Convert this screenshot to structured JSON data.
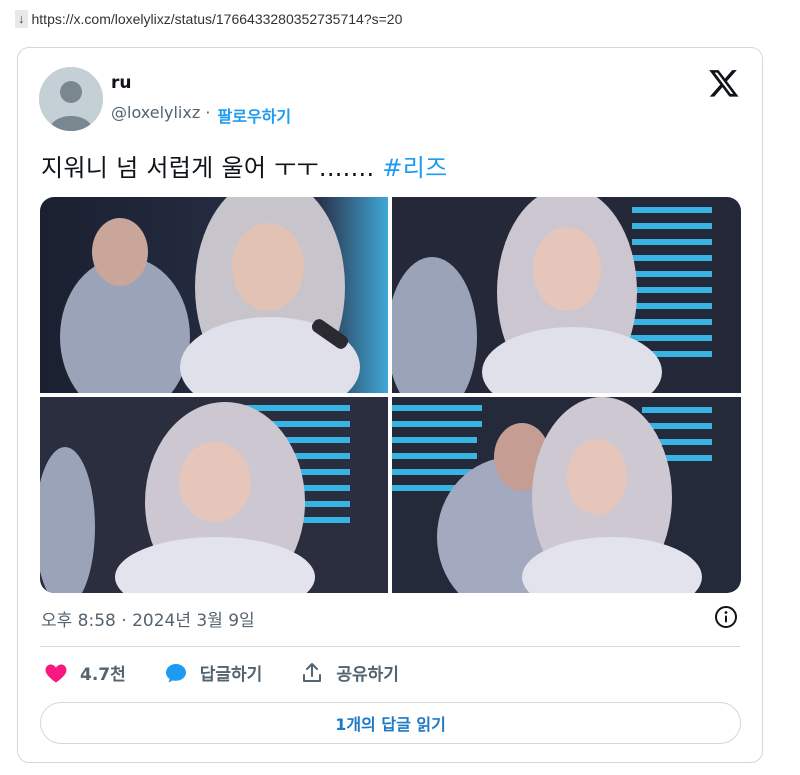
{
  "browser": {
    "download_arrow": "↓",
    "url": "https://x.com/loxelylixz/status/1766433280352735714?s=20"
  },
  "tweet": {
    "author_name": "ru",
    "author_handle": "@loxelylixz",
    "separator": " · ",
    "follow_label": "팔로우하기",
    "text": "지워니 넘 서럽게 울어 ㅜㅜ....... ",
    "hashtag": "#리즈",
    "timestamp": "오후 8:58 · 2024년 3월 9일",
    "like_count": "4.7천",
    "reply_label": "답글하기",
    "share_label": "공유하기",
    "read_replies_label": "1개의 답글 읽기"
  },
  "colors": {
    "accent": "#1d9bf0",
    "like": "#f91880",
    "muted": "#536471",
    "border": "#cfd9de"
  },
  "icons": [
    "download-arrow-icon",
    "x-logo-icon",
    "info-icon",
    "heart-icon",
    "reply-bubble-icon",
    "share-icon"
  ]
}
